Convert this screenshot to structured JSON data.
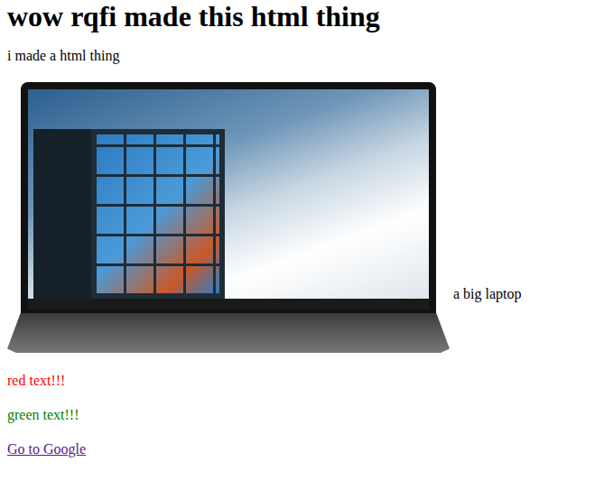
{
  "page": {
    "title": "wow rqfi made this html thing",
    "intro": "i made a html thing"
  },
  "image": {
    "caption": "a big laptop"
  },
  "colored_texts": [
    {
      "text": "red text!!!",
      "color": "#ff0000"
    },
    {
      "text": "green text!!!",
      "color": "#008000"
    }
  ],
  "link": {
    "label": "Go to Google",
    "visited": true
  }
}
